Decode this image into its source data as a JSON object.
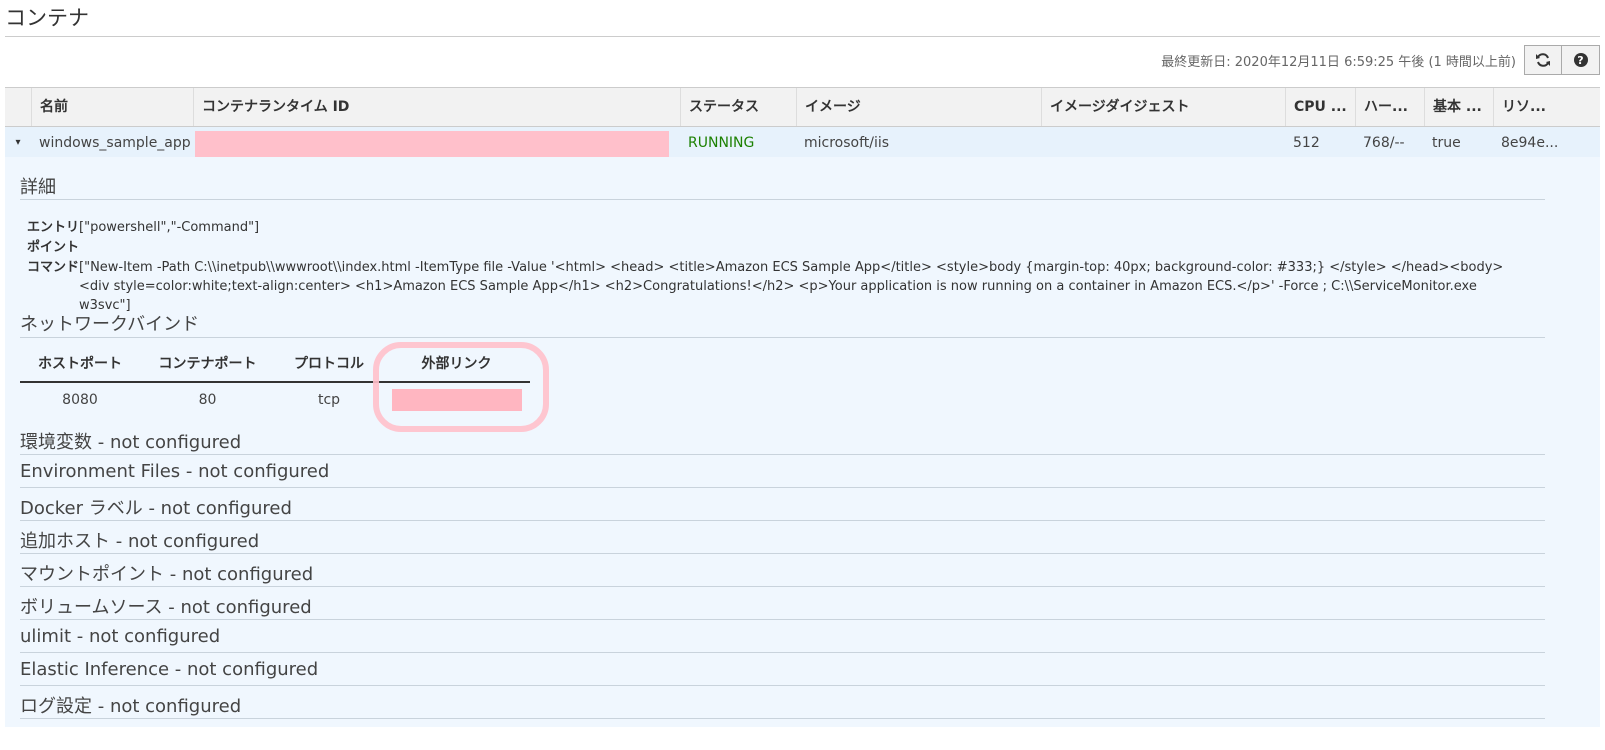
{
  "page": {
    "title": "コンテナ"
  },
  "toolbar": {
    "last_updated": "最終更新日: 2020年12月11日 6:59:25 午後 (1 時間以上前)",
    "refresh_icon": "refresh-icon",
    "help_icon": "help-icon",
    "help_glyph": "?"
  },
  "table": {
    "columns": [
      "名前",
      "コンテナランタイム ID",
      "ステータス",
      "イメージ",
      "イメージダイジェスト",
      "CPU ...",
      "ハー...",
      "基本 ...",
      "リソ..."
    ],
    "row": {
      "caret": "▾",
      "name": "windows_sample_app",
      "runtime_id": "",
      "status": "RUNNING",
      "image": "microsoft/iis",
      "digest": "",
      "cpu": "512",
      "memory": "768/--",
      "essential": "true",
      "resource": "8e94e..."
    }
  },
  "details": {
    "title": "詳細",
    "entry_label_1": "エントリ",
    "entry_value": "[\"powershell\",\"-Command\"]",
    "entry_label_2": "ポイント",
    "command_label": "コマンド",
    "command_value": "[\"New-Item -Path C:\\\\inetpub\\\\wwwroot\\\\index.html -ItemType file -Value '<html> <head> <title>Amazon ECS Sample App</title> <style>body {margin-top: 40px; background-color: #333;} </style> </head><body> <div style=color:white;text-align:center> <h1>Amazon ECS Sample App</h1> <h2>Congratulations!</h2> <p>Your application is now running on a container in Amazon ECS.</p>' -Force ; C:\\\\ServiceMonitor.exe w3svc\"]"
  },
  "network": {
    "title": "ネットワークバインド",
    "headers": [
      "ホストポート",
      "コンテナポート",
      "プロトコル",
      "外部リンク"
    ],
    "row": {
      "host_port": "8080",
      "container_port": "80",
      "protocol": "tcp",
      "external_link": ""
    }
  },
  "sections": [
    "環境変数 - not configured",
    "Environment Files - not configured",
    "Docker ラベル - not configured",
    "追加ホスト - not configured",
    "マウントポイント - not configured",
    "ボリュームソース - not configured",
    "ulimit - not configured",
    "Elastic Inference - not configured",
    "ログ設定 - not configured"
  ],
  "colors": {
    "status_running": "#1d8102",
    "redaction": "#ffc0cb",
    "row_bg": "#e7f2fc"
  }
}
